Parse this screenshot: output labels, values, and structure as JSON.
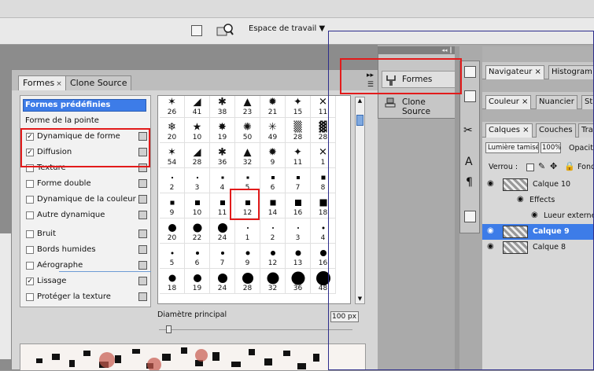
{
  "toolbar": {
    "workspace_label": "Espace de travail"
  },
  "brush_panel": {
    "tabs": [
      {
        "label": "Formes"
      },
      {
        "label": "Clone Source"
      }
    ],
    "list": [
      {
        "label": "Formes prédéfinies",
        "checked": false,
        "header": true
      },
      {
        "label": "Forme de la pointe",
        "checked": false,
        "header": true
      },
      {
        "label": "Dynamique de forme",
        "checked": true
      },
      {
        "label": "Diffusion",
        "checked": true
      },
      {
        "label": "Texture",
        "checked": false
      },
      {
        "label": "Forme double",
        "checked": false
      },
      {
        "label": "Dynamique de la couleur",
        "checked": false
      },
      {
        "label": "Autre dynamique",
        "checked": false
      },
      {
        "label": "Bruit",
        "checked": false
      },
      {
        "label": "Bords humides",
        "checked": false
      },
      {
        "label": "Aérographe",
        "checked": false
      },
      {
        "label": "Lissage",
        "checked": true
      },
      {
        "label": "Protéger la texture",
        "checked": false
      }
    ],
    "presets": [
      [
        "26",
        "41",
        "38",
        "23",
        "21",
        "15",
        "11"
      ],
      [
        "20",
        "10",
        "19",
        "50",
        "49",
        "28",
        "28"
      ],
      [
        "54",
        "28",
        "36",
        "32",
        "9",
        "11",
        "1"
      ],
      [
        "2",
        "3",
        "4",
        "5",
        "6",
        "7",
        "8"
      ],
      [
        "9",
        "10",
        "11",
        "12",
        "14",
        "16",
        "18"
      ],
      [
        "20",
        "22",
        "24",
        "1",
        "2",
        "3",
        "4"
      ],
      [
        "5",
        "6",
        "7",
        "9",
        "12",
        "13",
        "16"
      ],
      [
        "18",
        "19",
        "24",
        "28",
        "32",
        "36",
        "48"
      ]
    ],
    "diameter_label": "Diamètre principal",
    "diameter_value": "100 px"
  },
  "dock": {
    "formes_label": "Formes",
    "clone_label": "Clone Source",
    "panel_tabs_1": [
      "Navigateur",
      "Histogram"
    ],
    "panel_tabs_2": [
      "Couleur",
      "Nuancier",
      "St"
    ],
    "panel_tabs_3": [
      "Calques",
      "Couches",
      "Tra"
    ],
    "blend_mode": "Lumière tamisée",
    "opacity_label": "Opacit",
    "opacity_value": "100%",
    "lock_label": "Verrou :",
    "fill_label": "Fond",
    "layers": [
      {
        "name": "Calque 10",
        "selected": false
      },
      {
        "name": "Effects",
        "selected": false,
        "sub": true
      },
      {
        "name": "Lueur externe",
        "selected": false,
        "sub2": true
      },
      {
        "name": "Calque 9",
        "selected": true
      },
      {
        "name": "Calque 8",
        "selected": false
      }
    ]
  },
  "colors": {
    "highlight": "#e21b1b",
    "selection": "#3d7ce8"
  }
}
